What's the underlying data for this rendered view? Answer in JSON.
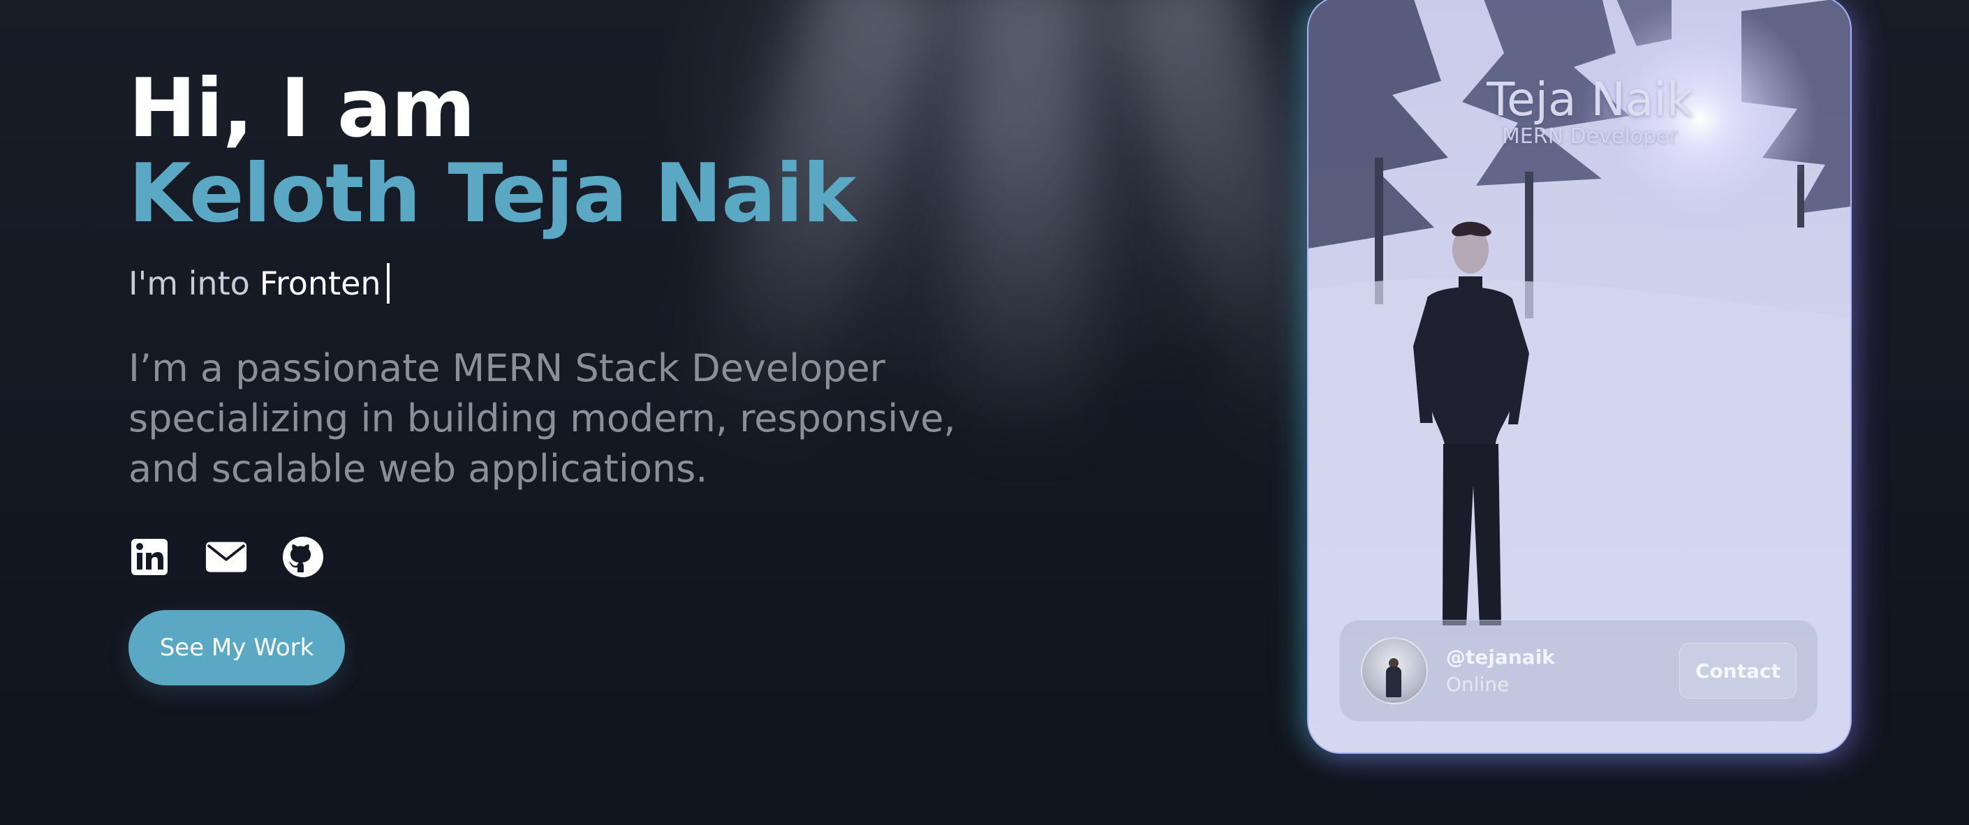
{
  "hero": {
    "greeting": "Hi, I am",
    "name": "Keloth Teja Naik",
    "typing_prefix": "I'm into",
    "typing_word": "Fronten",
    "bio": "I’m a passionate MERN Stack Developer specializing in building modern, responsive, and scalable web applications.",
    "cta_label": "See My Work",
    "socials": [
      {
        "icon": "linkedin-icon"
      },
      {
        "icon": "mail-icon"
      },
      {
        "icon": "github-icon"
      }
    ]
  },
  "card": {
    "title": "Teja Naik",
    "subtitle": "MERN Developer",
    "handle": "@tejanaik",
    "status": "Online",
    "contact_label": "Contact"
  },
  "colors": {
    "background": "#121621",
    "accent": "#5ba8c5",
    "text_primary": "#ffffff",
    "text_muted": "#8a8f9a"
  }
}
